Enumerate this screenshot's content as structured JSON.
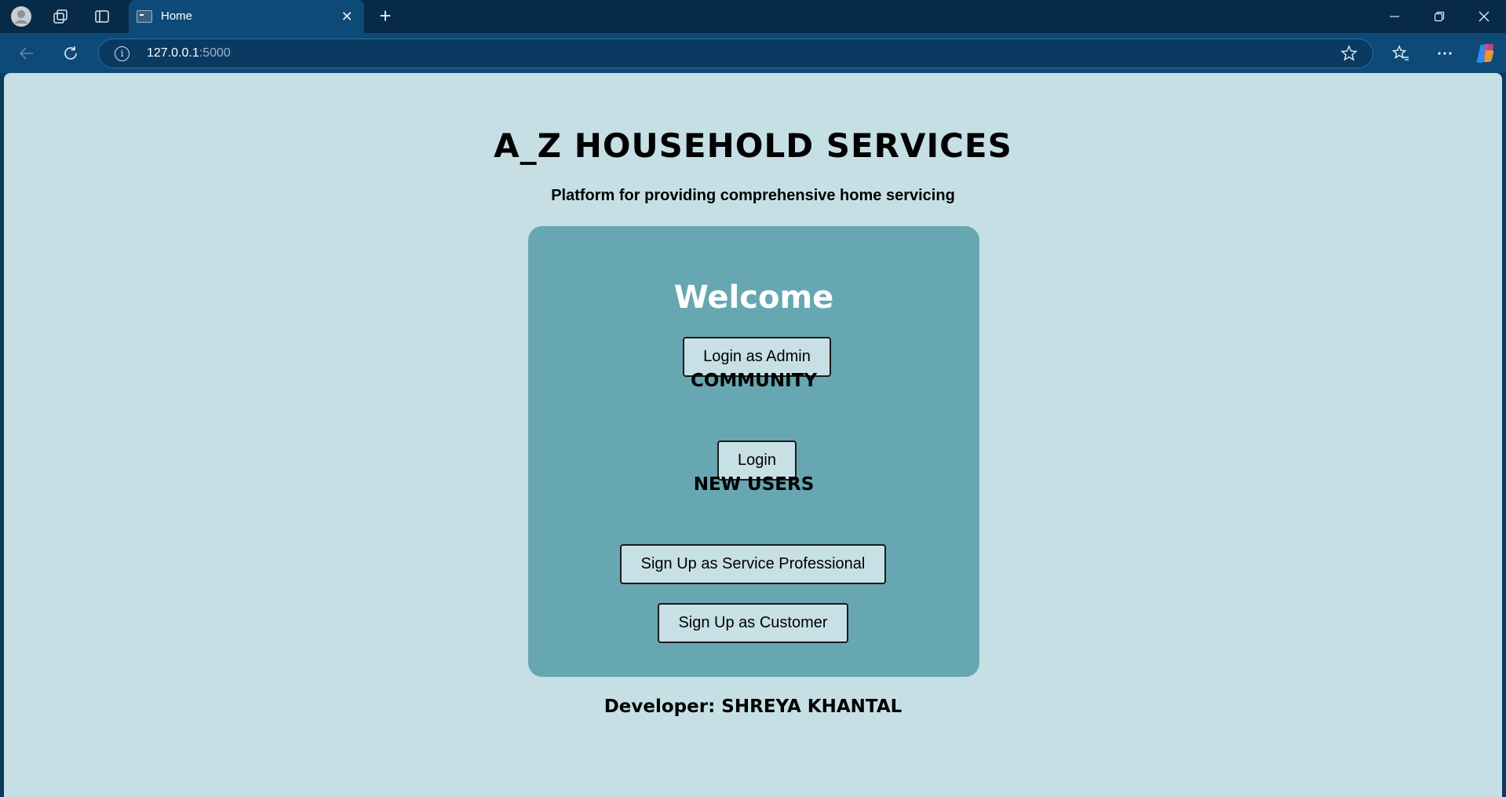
{
  "browser": {
    "tab_title": "Home",
    "url_host": "127.0.0.1",
    "url_port": ":5000"
  },
  "page": {
    "title": "A_Z HOUSEHOLD SERVICES",
    "subtitle": "Platform for providing comprehensive home servicing",
    "welcome": "Welcome",
    "admin_button": "Login as Admin",
    "community_heading": "COMMUNITY",
    "login_button": "Login",
    "new_users_heading": "NEW USERS",
    "signup_professional_button": "Sign Up as Service Professional",
    "signup_customer_button": "Sign Up as Customer",
    "developer": "Developer: SHREYA KHANTAL"
  },
  "colors": {
    "page_background": "#c5dfe5",
    "card_background": "#67a7b1",
    "button_background": "#c7e0e5",
    "welcome_text": "#ffffff"
  },
  "icons": [
    "profile-icon",
    "workspaces-icon",
    "tab-actions-icon",
    "close-icon",
    "new-tab-icon",
    "minimize-icon",
    "restore-icon",
    "window-close-icon",
    "back-icon",
    "refresh-icon",
    "info-icon",
    "favorite-star-icon",
    "favorites-icon",
    "more-icon",
    "copilot-icon"
  ]
}
